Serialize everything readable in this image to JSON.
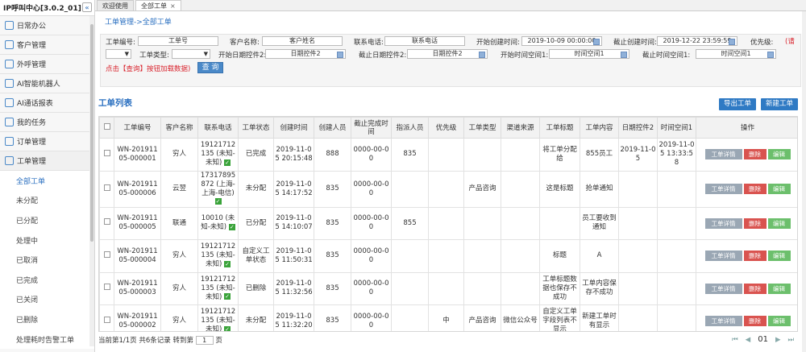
{
  "app": {
    "title": "IP呼叫中心[3.0.2_01]",
    "collapse_icon": "«"
  },
  "sidebar": {
    "menus": [
      {
        "label": "日常办公"
      },
      {
        "label": "客户管理"
      },
      {
        "label": "外呼管理"
      },
      {
        "label": "AI智能机器人"
      },
      {
        "label": "AI通话报表"
      },
      {
        "label": "我的任务"
      },
      {
        "label": "订单管理"
      },
      {
        "label": "工单管理"
      }
    ],
    "subs": [
      {
        "label": "全部工单"
      },
      {
        "label": "未分配"
      },
      {
        "label": "已分配"
      },
      {
        "label": "处理中"
      },
      {
        "label": "已取消"
      },
      {
        "label": "已完成"
      },
      {
        "label": "已关闭"
      },
      {
        "label": "已删除"
      },
      {
        "label": "处理耗时告警工单"
      }
    ]
  },
  "tabs": [
    {
      "label": "欢迎使用"
    },
    {
      "label": "全部工单"
    }
  ],
  "tab_close": "×",
  "breadcrumb": "工单管理->全部工单",
  "filters": {
    "ticket_no_label": "工单编号:",
    "ticket_no_value": "工单号",
    "customer_label": "客户名称:",
    "customer_value": "客户姓名",
    "phone_label": "联系电话:",
    "phone_value": "联系电话",
    "start_create_label": "开始创建时间:",
    "start_create_value": "2019-10-09 00:00:00",
    "end_create_label": "截止创建时间:",
    "end_create_value": "2019-12-22 23:59:59",
    "priority_label": "优先级:",
    "type_label": "工单类型:",
    "start_date2_label": "开始日期控件2:",
    "start_date2_value": "日期控件2",
    "end_date2_label": "截止日期控件2:",
    "end_date2_value": "日期控件2",
    "start_time1_label": "开始时间空间1:",
    "start_time1_value": "时间空间1",
    "end_time1_label": "截止时间空间1:",
    "end_time1_value": "时间空间1",
    "hint_tail": "(请",
    "hint": "点击【查询】按钮加载数据)",
    "search_btn": "查 询"
  },
  "list": {
    "title": "工单列表",
    "export_btn": "导出工单",
    "new_btn": "新建工单"
  },
  "table": {
    "headers": [
      "工单编号",
      "客户名称",
      "联系电话",
      "工单状态",
      "创建时间",
      "创建人员",
      "截止完成时间",
      "指派人员",
      "优先级",
      "工单类型",
      "渠道来源",
      "工单标题",
      "工单内容",
      "日期控件2",
      "时间空间1",
      "操作"
    ],
    "rows": [
      {
        "no": "WN-20191105-000001",
        "customer": "穷人",
        "phone": "19121712135 (未知-未知)",
        "status": "已完成",
        "created": "2019-11-05 20:15:48",
        "creator": "888",
        "deadline": "0000-00-00",
        "assignee": "835",
        "priority": "",
        "type": "",
        "channel": "",
        "title": "将工单分配给",
        "content": "855员工",
        "date2": "2019-11-05",
        "time1": "2019-11-05 13:33:58"
      },
      {
        "no": "WN-20191105-000006",
        "customer": "云翌",
        "phone": "17317895872 (上海-上海-电信)",
        "status": "未分配",
        "created": "2019-11-05 14:17:52",
        "creator": "835",
        "deadline": "0000-00-00",
        "assignee": "",
        "priority": "",
        "type": "产品咨询",
        "channel": "",
        "title": "这是标题",
        "content": "抢单通知",
        "date2": "",
        "time1": ""
      },
      {
        "no": "WN-20191105-000005",
        "customer": "联通",
        "phone": "10010 (未知-未知)",
        "status": "已分配",
        "created": "2019-11-05 14:10:07",
        "creator": "835",
        "deadline": "0000-00-00",
        "assignee": "855",
        "priority": "",
        "type": "",
        "channel": "",
        "title": "",
        "content": "员工要收到通知",
        "date2": "",
        "time1": ""
      },
      {
        "no": "WN-20191105-000004",
        "customer": "穷人",
        "phone": "19121712135 (未知-未知)",
        "status": "自定义工单状态",
        "created": "2019-11-05 11:50:31",
        "creator": "835",
        "deadline": "0000-00-00",
        "assignee": "",
        "priority": "",
        "type": "",
        "channel": "",
        "title": "标题",
        "content": "A",
        "date2": "",
        "time1": ""
      },
      {
        "no": "WN-20191105-000003",
        "customer": "穷人",
        "phone": "19121712135 (未知-未知)",
        "status": "已删除",
        "created": "2019-11-05 11:32:56",
        "creator": "835",
        "deadline": "0000-00-00",
        "assignee": "",
        "priority": "",
        "type": "",
        "channel": "",
        "title": "工单标题数据也保存不成功",
        "content": "工单内容保存不成功",
        "date2": "",
        "time1": ""
      },
      {
        "no": "WN-20191105-000002",
        "customer": "穷人",
        "phone": "19121712135 (未知-未知)",
        "status": "未分配",
        "created": "2019-11-05 11:32:20",
        "creator": "835",
        "deadline": "0000-00-00",
        "assignee": "",
        "priority": "中",
        "type": "产品咨询",
        "channel": "微信公众号",
        "title": "自定义工单字段列表不显示",
        "content": "新建工单时有显示",
        "date2": "",
        "time1": ""
      }
    ],
    "ops": {
      "detail": "工单详情",
      "delete": "删除",
      "edit": "编辑"
    }
  },
  "footer": {
    "text": "当前第1/1页 共6条记录 转到第",
    "page_value": "1",
    "page_suffix": "页"
  },
  "pager": {
    "first": "⏮",
    "prev": "◀",
    "current": "01",
    "next": "▶",
    "last": "⏭"
  }
}
